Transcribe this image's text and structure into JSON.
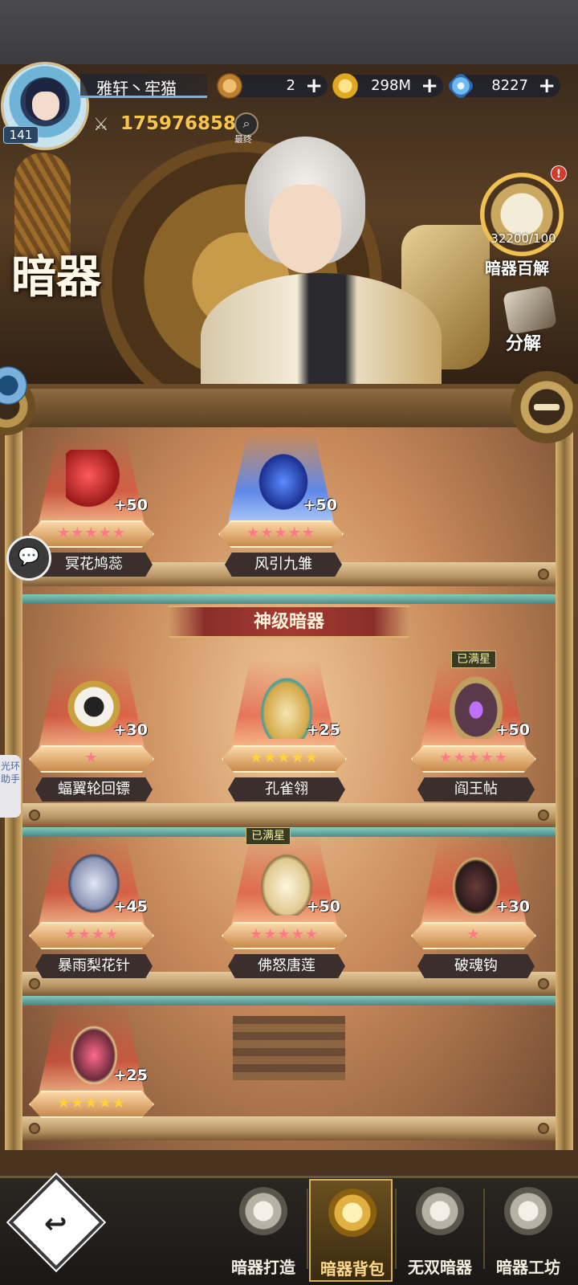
{
  "player": {
    "name": "雅轩丶牢猫",
    "level": "141",
    "power": "175976858",
    "search_label": "最终"
  },
  "currencies": [
    {
      "icon": "coin-icon",
      "value": "2"
    },
    {
      "icon": "gold-coin-icon",
      "value": "298M"
    },
    {
      "icon": "diamond-icon",
      "value": "8227"
    }
  ],
  "page": {
    "title": "暗器"
  },
  "codex": {
    "count": "32200/100",
    "label": "暗器百解"
  },
  "decompose": {
    "label": "分解"
  },
  "side_tab": {
    "label": "光环助手"
  },
  "section": {
    "title": "神级暗器"
  },
  "maxed_label": "已满星",
  "items": [
    {
      "name": "冥花鸠蕊",
      "plus": "+50",
      "stars": "★★★★★",
      "star_color": "pink",
      "glow": "red",
      "maxed": false
    },
    {
      "name": "风引九雏",
      "plus": "+50",
      "stars": "★★★★★",
      "star_color": "pink",
      "glow": "blue",
      "maxed": false
    },
    {
      "name": "蝠翼轮回镖",
      "plus": "+30",
      "stars": "★",
      "star_color": "pink",
      "glow": "red",
      "maxed": false
    },
    {
      "name": "孔雀翎",
      "plus": "+25",
      "stars": "★★★★★",
      "star_color": "gold",
      "glow": "red",
      "maxed": false
    },
    {
      "name": "阎王帖",
      "plus": "+50",
      "stars": "★★★★★",
      "star_color": "pink",
      "glow": "red",
      "maxed": true
    },
    {
      "name": "暴雨梨花针",
      "plus": "+45",
      "stars": "★★★★",
      "star_color": "pink",
      "glow": "red",
      "maxed": false
    },
    {
      "name": "佛怒唐莲",
      "plus": "+50",
      "stars": "★★★★★",
      "star_color": "pink",
      "glow": "red",
      "maxed": true
    },
    {
      "name": "破魂钩",
      "plus": "+30",
      "stars": "★",
      "star_color": "pink",
      "glow": "red",
      "maxed": false
    },
    {
      "name": "",
      "plus": "+25",
      "stars": "★★★★★",
      "star_color": "gold",
      "glow": "red",
      "maxed": false
    }
  ],
  "nav": {
    "back_icon": "back-arrow-icon",
    "tabs": [
      {
        "label": "暗器打造",
        "icon": "hammer-icon",
        "active": false
      },
      {
        "label": "暗器背包",
        "icon": "claw-icon",
        "active": true
      },
      {
        "label": "无双暗器",
        "icon": "trident-icon",
        "active": false
      },
      {
        "label": "暗器工坊",
        "icon": "workshop-icon",
        "active": false
      }
    ]
  },
  "colors": {
    "power_text": "#f7c64a",
    "active_tab": "#ffd98a",
    "pink_star": "#ff7a88",
    "gold_star": "#ffd23a"
  }
}
